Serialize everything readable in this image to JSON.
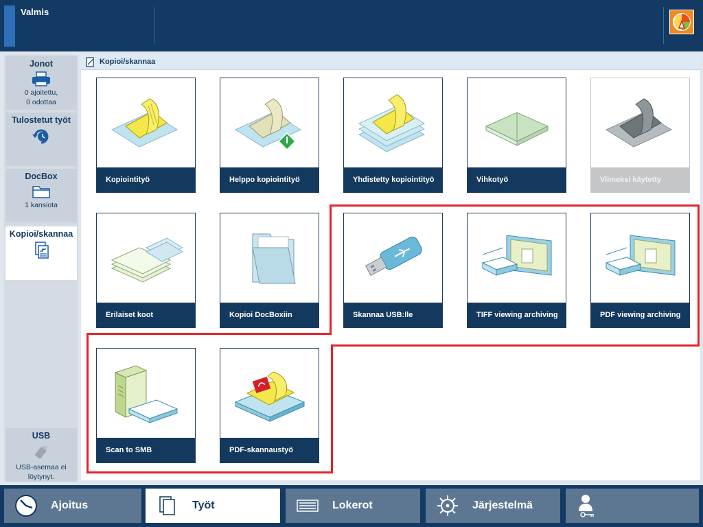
{
  "status": {
    "text": "Valmis"
  },
  "breadcrumb": {
    "label": "Kopioi/skannaa"
  },
  "sidebar": {
    "items": [
      {
        "title": "Jonot",
        "line1": "0 ajoitettu,",
        "line2": "0 odottaa"
      },
      {
        "title": "Tulostetut työt"
      },
      {
        "title": "DocBox",
        "line1": "1 kansiota"
      },
      {
        "title": "Kopioi/skannaa"
      },
      {
        "title": "USB",
        "line1": "USB-asemaa ei",
        "line2": "löytynyt."
      }
    ]
  },
  "tiles": [
    {
      "label": "Kopiointityö"
    },
    {
      "label": "Helppo kopiointityö"
    },
    {
      "label": "Yhdistetty kopiointityö"
    },
    {
      "label": "Vihkotyö"
    },
    {
      "label": "Viimeksi käytetty"
    },
    {
      "label": "Erilaiset koot"
    },
    {
      "label": "Kopioi DocBoxiin"
    },
    {
      "label": "Skannaa USB:lle"
    },
    {
      "label": "TIFF viewing archiving"
    },
    {
      "label": "PDF viewing archiving"
    },
    {
      "label": "Scan to SMB"
    },
    {
      "label": "PDF-skannaustyö"
    }
  ],
  "bottom_nav": {
    "tabs": [
      {
        "label": "Ajoitus"
      },
      {
        "label": "Työt"
      },
      {
        "label": "Lokerot"
      },
      {
        "label": "Järjestelmä"
      }
    ]
  },
  "colors": {
    "navy": "#14395e",
    "highlight": "#e3222a",
    "tab": "#5d7793"
  }
}
